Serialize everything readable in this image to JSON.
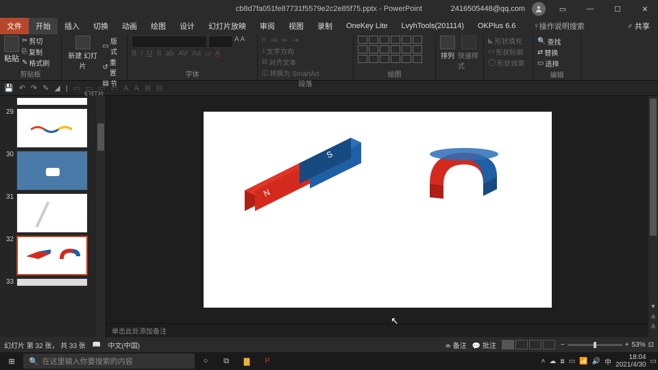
{
  "title": {
    "filename": "cb8d7fa051fe87731f5579e2c2e85f75.pptx",
    "app": "PowerPoint",
    "account": "2416505448@qq.com"
  },
  "menu": {
    "file": "文件",
    "home": "开始",
    "insert": "插入",
    "transition": "切换",
    "animation": "动画",
    "draw": "绘图",
    "design": "设计",
    "slideshow": "幻灯片放映",
    "review": "审阅",
    "view": "视图",
    "record": "录制",
    "onekey": "OneKey Lite",
    "lvyh": "LvyhTools(201114)",
    "okplus": "OKPlus 6.6",
    "help": "操作说明搜索",
    "share": "共享"
  },
  "ribbon": {
    "clipboard": {
      "paste": "粘贴",
      "cut": "剪切",
      "copy": "复制",
      "format_painter": "格式刷",
      "label": "剪贴板"
    },
    "slides": {
      "new_slide": "新建\n幻灯片",
      "layout": "版式",
      "reset": "重置",
      "section": "节",
      "label": "幻灯片"
    },
    "font": {
      "label": "字体"
    },
    "paragraph": {
      "text_dir": "文字方向",
      "align_text": "对齐文本",
      "smartart": "转换为 SmartArt",
      "label": "段落"
    },
    "drawing": {
      "arrange": "排列",
      "quick_style": "快速样式",
      "shape_fill": "形状填充",
      "shape_outline": "形状轮廓",
      "shape_effects": "形状效果",
      "label": "绘图"
    },
    "editing": {
      "find": "查找",
      "replace": "替换",
      "select": "选择",
      "label": "编辑"
    }
  },
  "thumbnails": [
    {
      "num": "29"
    },
    {
      "num": "30"
    },
    {
      "num": "31"
    },
    {
      "num": "32",
      "selected": true
    },
    {
      "num": "33"
    }
  ],
  "notes_placeholder": "单击此处添加备注",
  "status": {
    "slide_info": "幻灯片 第 32 张， 共 33 张",
    "lang": "中文(中国)",
    "notes_btn": "备注",
    "comments_btn": "批注",
    "zoom": "53%"
  },
  "taskbar": {
    "search_placeholder": "在这里输入你要搜索的内容",
    "time": "18:04",
    "date": "2021/4/30"
  },
  "slide_content": {
    "bar_s": "S",
    "bar_n": "N"
  },
  "colors": {
    "accent": "#c43e1c",
    "blue": "#1f5fa5",
    "red": "#d42a1e"
  }
}
